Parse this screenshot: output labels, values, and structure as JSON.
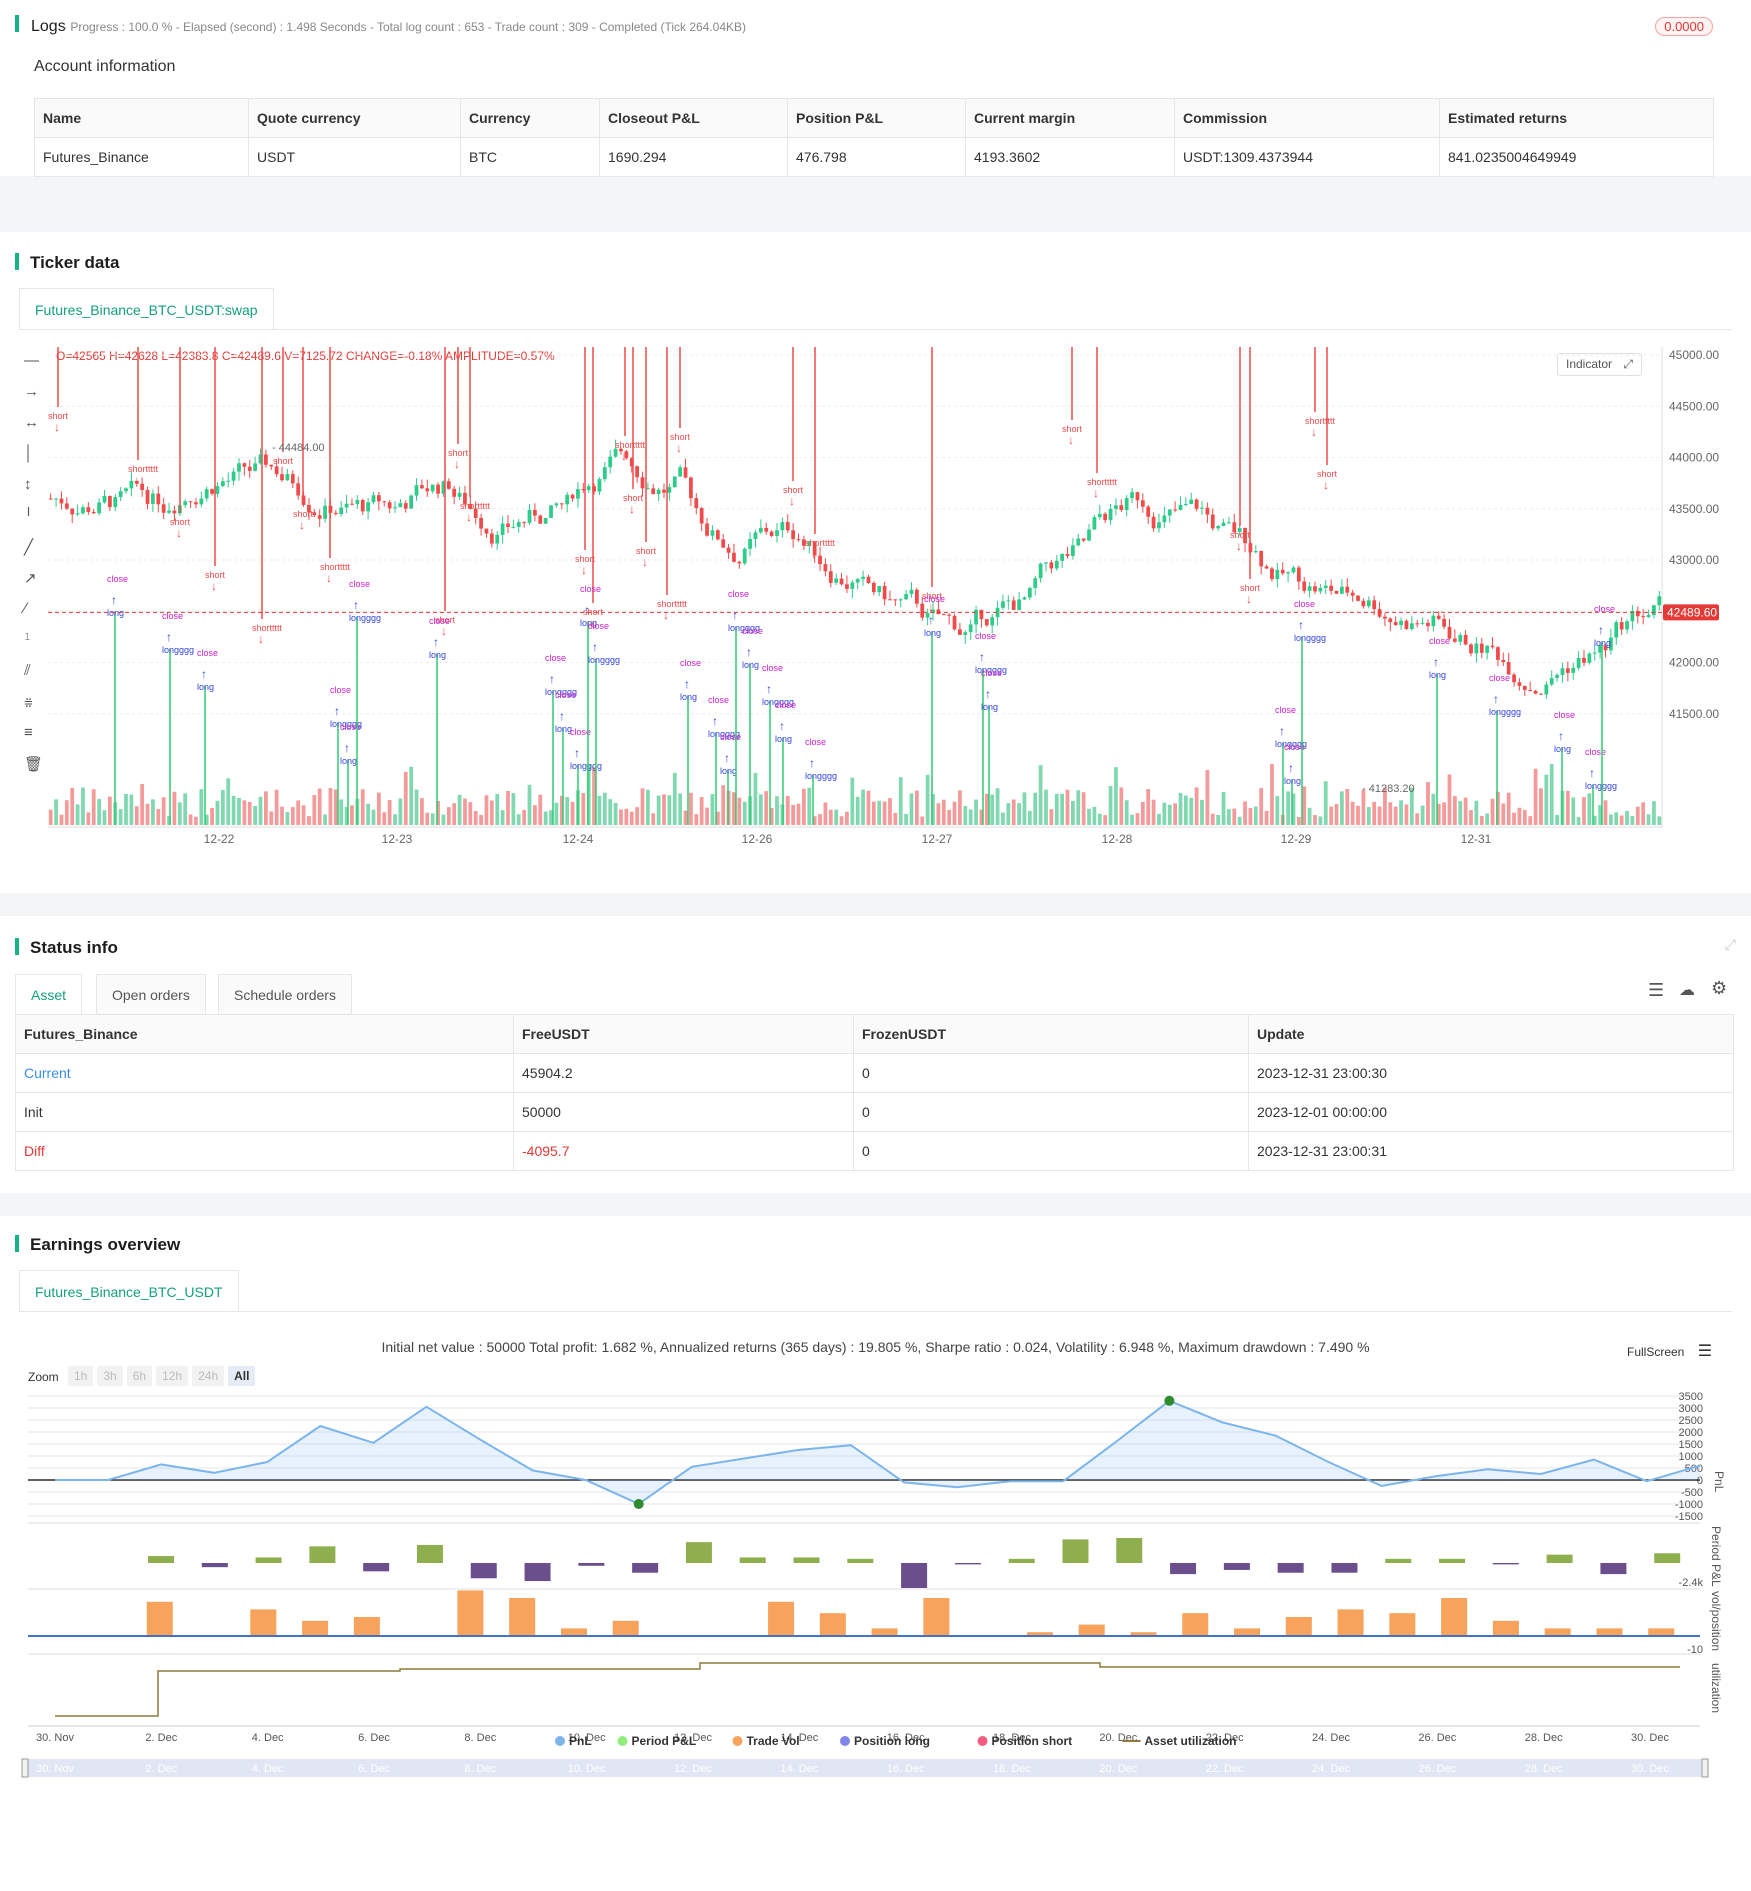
{
  "logs": {
    "title": "Logs",
    "summary": "- Progress : 100.0 % - Elapsed (second) : 1.498  Seconds - Total log count : 653 - Trade count : 309 - Completed (Tick 264.04KB)",
    "badge": "0.0000"
  },
  "account": {
    "title": "Account information",
    "headers": [
      "Name",
      "Quote currency",
      "Currency",
      "Closeout P&L",
      "Position P&L",
      "Current margin",
      "Commission",
      "Estimated returns"
    ],
    "row": [
      "Futures_Binance",
      "USDT",
      "BTC",
      "1690.294",
      "476.798",
      "4193.3602",
      "USDT:1309.4373944",
      "841.0235004649949"
    ]
  },
  "ticker": {
    "title": "Ticker data",
    "tab": "Futures_Binance_BTC_USDT:swap",
    "ohlc_line": "O=42565 H=42628 L=42383.8 C=42489.6 V=7125.72 CHANGE=-0.18% AMPLITUDE=0.57%",
    "indicator_btn": "Indicator",
    "last_price": "42489.60",
    "high_mark": "44484.00",
    "low_mark": "41283.20",
    "price_ticks": [
      "45000.00",
      "44500.00",
      "44000.00",
      "43500.00",
      "43000.00",
      "42500.00",
      "42000.00",
      "41500.00"
    ],
    "date_ticks": [
      "12-22",
      "12-23",
      "12-24",
      "12-26",
      "12-27",
      "12-28",
      "12-29",
      "12-31"
    ],
    "signal_labels": [
      "short",
      "shorttttt",
      "close",
      "long",
      "longggg"
    ]
  },
  "status": {
    "title": "Status info",
    "tabs": [
      "Asset",
      "Open orders",
      "Schedule orders"
    ],
    "headers": [
      "Futures_Binance",
      "FreeUSDT",
      "FrozenUSDT",
      "Update"
    ],
    "rows": [
      [
        "Current",
        "45904.2",
        "0",
        "2023-12-31 23:00:30"
      ],
      [
        "Init",
        "50000",
        "0",
        "2023-12-01 00:00:00"
      ],
      [
        "Diff",
        "-4095.7",
        "0",
        "2023-12-31 23:00:31"
      ]
    ]
  },
  "earnings": {
    "title": "Earnings overview",
    "tab": "Futures_Binance_BTC_USDT",
    "summary": "Initial net value : 50000 Total profit: 1.682 %, Annualized returns (365 days) : 19.805 %, Sharpe ratio : 0.024, Volatility : 6.948 %, Maximum drawdown : 7.490 %",
    "fullscreen": "FullScreen",
    "zoom_label": "Zoom",
    "zoom_buttons": [
      "1h",
      "3h",
      "6h",
      "12h",
      "24h",
      "All"
    ],
    "pnl_ticks": [
      "3500",
      "3000",
      "2500",
      "2000",
      "1500",
      "1000",
      "500",
      "0",
      "-500",
      "-1000",
      "-1500"
    ],
    "axis_titles": [
      "PnL",
      "Period P&L",
      "vol/position",
      "utilization"
    ],
    "period_tick": "-2.4k",
    "vol_tick": "-10",
    "x_ticks": [
      "30. Nov",
      "2. Dec",
      "4. Dec",
      "6. Dec",
      "8. Dec",
      "10. Dec",
      "12. Dec",
      "14. Dec",
      "16. Dec",
      "18. Dec",
      "20. Dec",
      "22. Dec",
      "24. Dec",
      "26. Dec",
      "28. Dec",
      "30. Dec"
    ],
    "legend": [
      {
        "name": "PnL",
        "color": "#7cb5ec"
      },
      {
        "name": "Period P&L",
        "color": "#90ed7d"
      },
      {
        "name": "Trade Vol",
        "color": "#f7a35c"
      },
      {
        "name": "Position long",
        "color": "#8085e9"
      },
      {
        "name": "Position short",
        "color": "#f15c80"
      },
      {
        "name": "Asset utilization",
        "color": "#8d7a3c"
      }
    ]
  },
  "chart_data": {
    "type": "line",
    "series": [
      {
        "name": "PnL",
        "x": [
          "30. Nov",
          "1. Dec",
          "2. Dec",
          "3. Dec",
          "4. Dec",
          "5. Dec",
          "6. Dec",
          "7. Dec",
          "8. Dec",
          "9. Dec",
          "10. Dec",
          "11. Dec",
          "12. Dec",
          "13. Dec",
          "14. Dec",
          "15. Dec",
          "16. Dec",
          "17. Dec",
          "18. Dec",
          "19. Dec",
          "20. Dec",
          "21. Dec",
          "22. Dec",
          "23. Dec",
          "24. Dec",
          "25. Dec",
          "26. Dec",
          "27. Dec",
          "28. Dec",
          "29. Dec",
          "30. Dec",
          "31. Dec"
        ],
        "values": [
          0,
          0,
          650,
          300,
          750,
          2250,
          1550,
          3050,
          1700,
          400,
          0,
          -1000,
          550,
          900,
          1250,
          1450,
          -100,
          -300,
          -50,
          -50,
          1600,
          3300,
          2400,
          1850,
          750,
          -250,
          150,
          450,
          250,
          850,
          -50,
          600
        ]
      },
      {
        "name": "Period P&L",
        "values": [
          500,
          -300,
          400,
          1200,
          -600,
          1300,
          -1100,
          -1300,
          -200,
          -700,
          1500,
          400,
          400,
          300,
          -1800,
          -100,
          300,
          1700,
          1800,
          -800,
          -500,
          -700,
          -700,
          300,
          300,
          -100,
          600,
          -800,
          700
        ]
      },
      {
        "name": "Trade Vol",
        "values": [
          0,
          9,
          0,
          7,
          4,
          5,
          0,
          12,
          10,
          2,
          4,
          0,
          0,
          9,
          6,
          2,
          10,
          0,
          1,
          3,
          1,
          6,
          2,
          5,
          7,
          6,
          10,
          4,
          2,
          2,
          2
        ]
      }
    ],
    "ylim": [
      -1500,
      3500
    ]
  }
}
